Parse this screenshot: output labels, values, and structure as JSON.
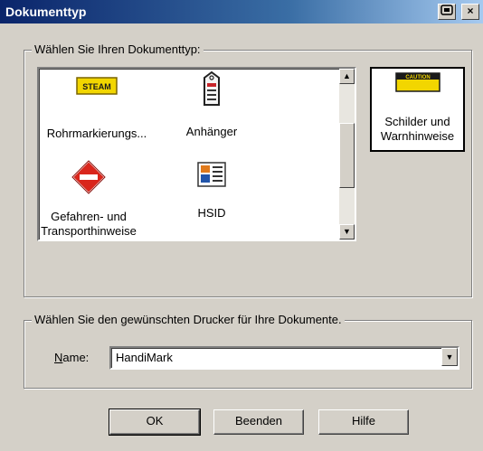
{
  "window": {
    "title": "Dokumenttyp",
    "help_button": "?",
    "close_button": "×"
  },
  "doc_type_group": {
    "legend": "Wählen Sie Ihren Dokumenttyp:",
    "items": [
      {
        "label": "Rohrmarkierungs...",
        "icon": "steam-pipe-marker-icon",
        "icon_text": "STEAM"
      },
      {
        "label": "Anhänger",
        "icon": "tag-icon"
      },
      {
        "label_line1": "Gefahren- und",
        "label_line2": "Transporthinweise",
        "icon": "hazard-diamond-icon"
      },
      {
        "label": "HSID",
        "icon": "hsid-document-icon"
      }
    ],
    "selected": {
      "label_line1": "Schilder und",
      "label_line2": "Warnhinweise",
      "icon": "caution-sign-icon",
      "icon_text": "CAUTION"
    }
  },
  "printer_group": {
    "legend": "Wählen Sie den gewünschten Drucker für Ihre Dokumente.",
    "name_label_access": "N",
    "name_label_rest": "ame:",
    "printer_value": "HandiMark"
  },
  "buttons": {
    "ok": "OK",
    "exit": "Beenden",
    "help": "Hilfe"
  },
  "colors": {
    "titlebar_start": "#0a246a",
    "face": "#d4d0c8",
    "steam_yellow": "#f2d600",
    "hazard_red": "#d9261c"
  }
}
